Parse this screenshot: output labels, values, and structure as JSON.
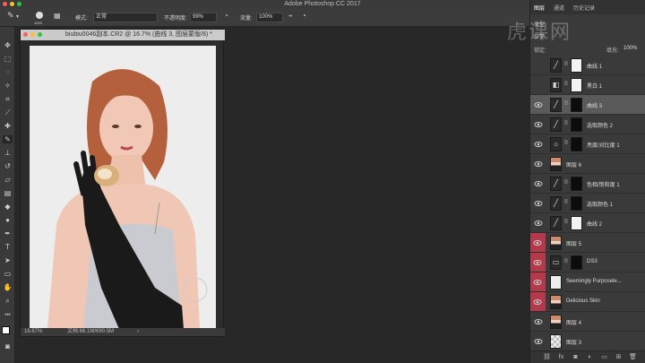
{
  "app_title": "Adobe Photoshop CC 2017",
  "options": {
    "brush_size": "1000",
    "mode_label": "模式:",
    "mode_value": "正常",
    "opacity_label": "不透明度:",
    "opacity_value": "99%",
    "flow_label": "流量:",
    "flow_value": "100%"
  },
  "document": {
    "tab_title": "biubiu0046副本.CR2 @ 16.7% (曲线 3, 图层蒙版/8) *",
    "zoom": "16.67%",
    "doc_size": "文档:66.1M/690.5M"
  },
  "panel": {
    "tab_layers": "图层",
    "tab_channels": "通道",
    "tab_history": "历史记录",
    "fill_label": "填充:",
    "fill_value": "100%",
    "label_kind": "类型",
    "label_normal": "正常",
    "label_lock": "锁定:"
  },
  "layers": [
    {
      "name": "曲线 1",
      "visible": false,
      "type": "adjust",
      "mask": "white",
      "selected": false
    },
    {
      "name": "黑白 1",
      "visible": false,
      "type": "bw",
      "mask": "white",
      "selected": false
    },
    {
      "name": "曲线 3",
      "visible": true,
      "type": "adjust",
      "mask": "black",
      "selected": true
    },
    {
      "name": "选取颜色 2",
      "visible": true,
      "type": "adjust",
      "mask": "black",
      "selected": false
    },
    {
      "name": "亮度/对比度 1",
      "visible": true,
      "type": "sun",
      "mask": "black",
      "selected": false
    },
    {
      "name": "图层 6",
      "visible": true,
      "type": "photo",
      "mask": "",
      "selected": false
    },
    {
      "name": "色相/饱和度 1",
      "visible": true,
      "type": "adjust",
      "mask": "black",
      "selected": false
    },
    {
      "name": "选取颜色 1",
      "visible": true,
      "type": "adjust",
      "mask": "black",
      "selected": false
    },
    {
      "name": "曲线 2",
      "visible": true,
      "type": "adjust",
      "mask": "white",
      "selected": false
    },
    {
      "name": "图层 5",
      "visible": true,
      "type": "photo",
      "mask": "",
      "selected": false,
      "red": true
    },
    {
      "name": "DS3",
      "visible": true,
      "type": "folder",
      "mask": "black",
      "selected": false,
      "red": true
    },
    {
      "name": "Seemingly Purposele...",
      "visible": true,
      "type": "blank",
      "mask": "",
      "selected": false,
      "red": true
    },
    {
      "name": "Delicious Skin",
      "visible": true,
      "type": "photo",
      "mask": "",
      "selected": false,
      "red": true
    },
    {
      "name": "图层 4",
      "visible": true,
      "type": "photo",
      "mask": "",
      "selected": false
    },
    {
      "name": "图层 3",
      "visible": true,
      "type": "checker",
      "mask": "",
      "selected": false
    }
  ],
  "watermark": "虎课网",
  "colors": {
    "selected": "#5a5a5a",
    "red_eye": "#b33a4a",
    "accent_dot_red": "#ff5f57",
    "accent_dot_yellow": "#febc2e",
    "accent_dot_green": "#28c840"
  }
}
